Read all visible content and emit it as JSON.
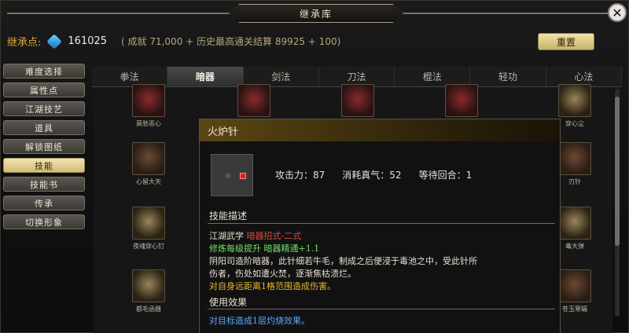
{
  "window": {
    "title": "继承库"
  },
  "points": {
    "label": "继承点:",
    "value": "161025",
    "formula": "( 成就 71,000 + 历史最高通关结算 89925 + 100)"
  },
  "reset_label": "重置",
  "side_menu": [
    {
      "label": "难度选择",
      "active": false
    },
    {
      "label": "属性点",
      "active": false
    },
    {
      "label": "江湖技艺",
      "active": false
    },
    {
      "label": "道具",
      "active": false
    },
    {
      "label": "解锁图纸",
      "active": false
    },
    {
      "label": "技能",
      "active": true
    },
    {
      "label": "技能书",
      "active": false
    },
    {
      "label": "传承",
      "active": false
    },
    {
      "label": "切换形象",
      "active": false
    }
  ],
  "tabs": [
    {
      "label": "拳法",
      "active": false
    },
    {
      "label": "暗器",
      "active": true
    },
    {
      "label": "剑法",
      "active": false
    },
    {
      "label": "刀法",
      "active": false
    },
    {
      "label": "棍法",
      "active": false
    },
    {
      "label": "轻功",
      "active": false
    },
    {
      "label": "心法",
      "active": false
    }
  ],
  "skills": [
    {
      "name": "莫愁恶心"
    },
    {
      "name": "心留大天"
    },
    {
      "name": "夜魂穿心钉"
    },
    {
      "name": "都毛函器"
    },
    {
      "name": "穿心尘"
    },
    {
      "name": "刃针"
    },
    {
      "name": "毒大弹"
    },
    {
      "name": "苍玉寒蝠"
    }
  ],
  "tooltip": {
    "title": "火炉针",
    "stats": {
      "attack": "攻击力：87",
      "cost": "消耗真气：52",
      "wait": "等待回合：1"
    },
    "desc_header": "技能描述",
    "line1_prefix": "江湖武学",
    "line1_tag": "暗器招式-二式",
    "line2": "修炼每级提升 暗器精通+1.1",
    "line3": "阴阳司造阶暗器，此针细若牛毛，制成之后便浸于毒池之中，受此针所",
    "line4": "伤者，伤处如遭火焚，逐渐焦枯溃烂。",
    "line5": "对自身远距离1格范围造成伤害。",
    "effect_header": "使用效果",
    "line6": "对目标造成1层灼烧效果。"
  },
  "icons": {
    "close": "close-icon",
    "gem": "gem-icon"
  },
  "colors": {
    "accent_gold": "#e8b830",
    "damage_red": "#e0493a",
    "buff_green": "#6fe06a",
    "effect_blue": "#5aa8ff"
  }
}
